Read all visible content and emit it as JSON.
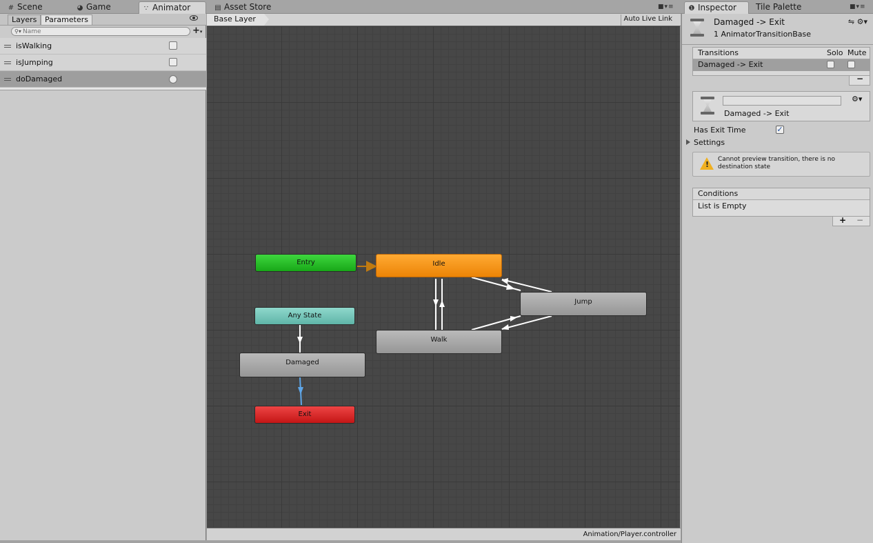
{
  "tabs_left": [
    {
      "label": "Scene",
      "icon": "hash-icon",
      "active": false
    },
    {
      "label": "Game",
      "icon": "pacman-icon",
      "active": false
    },
    {
      "label": "Animator",
      "icon": "nodes-icon",
      "active": true
    },
    {
      "label": "Asset Store",
      "icon": "bag-icon",
      "active": false
    }
  ],
  "tabs_right": [
    {
      "label": "Inspector",
      "icon": "info-icon",
      "active": true
    },
    {
      "label": "Tile Palette",
      "active": false
    }
  ],
  "left_panel": {
    "subtabs": [
      "Layers",
      "Parameters"
    ],
    "active_subtab": "Parameters",
    "search_placeholder": "Name",
    "parameters": [
      {
        "name": "isWalking",
        "type": "bool",
        "selected": false
      },
      {
        "name": "isJumping",
        "type": "bool",
        "selected": false
      },
      {
        "name": "doDamaged",
        "type": "trigger",
        "selected": true
      }
    ]
  },
  "graph": {
    "breadcrumb": "Base Layer",
    "auto_live_link": "Auto Live Link",
    "footer_path": "Animation/Player.controller",
    "nodes": {
      "entry": "Entry",
      "idle": "Idle",
      "any_state": "Any State",
      "jump": "Jump",
      "walk": "Walk",
      "damaged": "Damaged",
      "exit": "Exit"
    },
    "colors": {
      "entry": "#2ebd2e",
      "idle": "#f59a1f",
      "any_state": "#79c8bc",
      "exit": "#d92a2a",
      "state": "#a8a8a8",
      "selected_transition": "#5ea6e8",
      "default_transition": "#c07a10"
    }
  },
  "inspector": {
    "title": "Damaged -> Exit",
    "subtitle": "1 AnimatorTransitionBase",
    "transitions": {
      "header": "Transitions",
      "solo_label": "Solo",
      "mute_label": "Mute",
      "rows": [
        {
          "name": "Damaged -> Exit",
          "solo": false,
          "mute": false
        }
      ],
      "remove_label": "−"
    },
    "transition_name_value": "",
    "transition_label": "Damaged -> Exit",
    "has_exit_time_label": "Has Exit Time",
    "has_exit_time": true,
    "settings_label": "Settings",
    "warning": "Cannot preview transition, there is no destination state",
    "conditions": {
      "header": "Conditions",
      "empty_text": "List is Empty",
      "add_label": "+",
      "remove_label": "−"
    }
  }
}
